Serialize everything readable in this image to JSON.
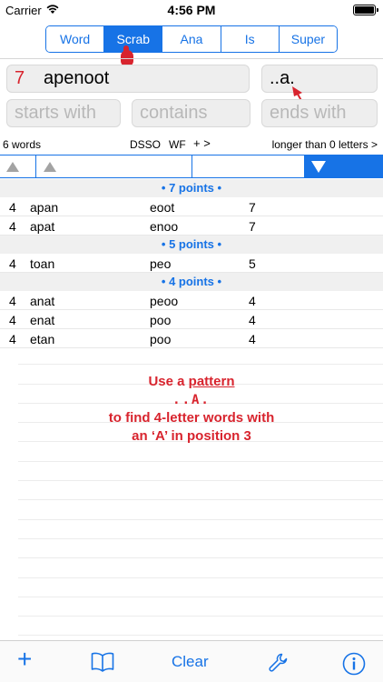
{
  "status": {
    "carrier": "Carrier",
    "time": "4:56 PM"
  },
  "tabs": [
    "Word",
    "Scrab",
    "Ana",
    "Is",
    "Super"
  ],
  "search": {
    "count": "7",
    "letters": "apenoot",
    "pattern": "..a.",
    "starts_placeholder": "starts with",
    "contains_placeholder": "contains",
    "ends_placeholder": "ends with"
  },
  "info": {
    "word_count": "6 words",
    "dsso": "DSSO",
    "wf": "WF",
    "plus": "+ >",
    "longer": "longer than 0 letters >"
  },
  "results": {
    "group1": "• 7 points •",
    "group2": "• 5 points •",
    "group3": "• 4 points •",
    "rows": [
      [
        "4",
        "apan",
        "eoot",
        "7"
      ],
      [
        "4",
        "apat",
        "enoo",
        "7"
      ],
      [
        "4",
        "toan",
        "peo",
        "5"
      ],
      [
        "4",
        "anat",
        "peoo",
        "4"
      ],
      [
        "4",
        "enat",
        "poo",
        "4"
      ],
      [
        "4",
        "etan",
        "poo",
        "4"
      ]
    ]
  },
  "note": {
    "line1a": "Use a ",
    "line1b": "pattern",
    "line2": "..A.",
    "line3": "to find 4-letter words with",
    "line4": "an ‘A’ in position 3"
  },
  "toolbar": {
    "clear": "Clear"
  },
  "colors": {
    "accent": "#1773e6",
    "red": "#d8242e"
  },
  "icons": [
    "wifi-icon",
    "battery-icon",
    "sort-up-icon",
    "sort-down-icon",
    "plus-icon",
    "book-icon",
    "wrench-icon",
    "info-icon"
  ]
}
